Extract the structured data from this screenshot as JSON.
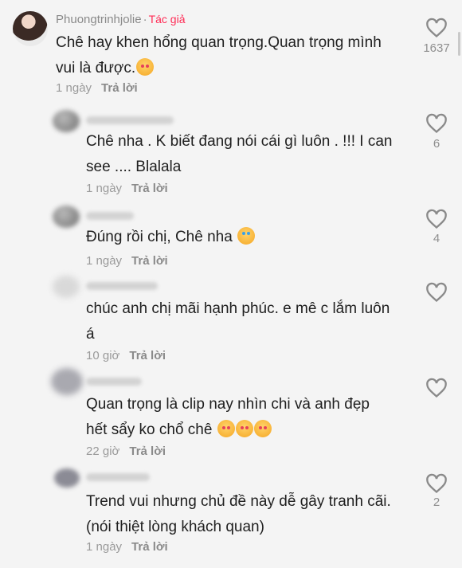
{
  "comments": [
    {
      "author": "Phuongtrinhjolie",
      "author_tag": "Tác giả",
      "lines": [
        "Chê hay khen hổng quan trọng.Quan trọng mình",
        "vui là được."
      ],
      "emoji": "smiling-face-with-hearts",
      "time": "1 ngày",
      "reply": "Trả lời",
      "likes": "1637"
    },
    {
      "lines": [
        "Chê nha . K biết đang nói cái gì luôn . !!! I can",
        "see .... Blalala"
      ],
      "time": "1 ngày",
      "reply": "Trả lời",
      "likes": "6"
    },
    {
      "lines": [
        "Đúng rồi chị, Chê nha"
      ],
      "emoji": "face-with-tears-of-joy",
      "time": "1 ngày",
      "reply": "Trả lời",
      "likes": "4"
    },
    {
      "lines": [
        "chúc anh chị mãi hạnh phúc. e mê c lắm luôn",
        "á"
      ],
      "time": "10 giờ",
      "reply": "Trả lời",
      "likes": ""
    },
    {
      "lines": [
        "Quan trọng là clip nay nhìn chi và anh đẹp",
        "hết sẩy ko chổ chê"
      ],
      "emoji": "smiling-face-with-hearts x3",
      "time": "22 giờ",
      "reply": "Trả lời",
      "likes": ""
    },
    {
      "lines": [
        "Trend vui nhưng chủ đề này dễ gây tranh cãi.",
        "(nói thiệt lòng khách quan)"
      ],
      "time": "1 ngày",
      "reply": "Trả lời",
      "likes": "2"
    }
  ]
}
